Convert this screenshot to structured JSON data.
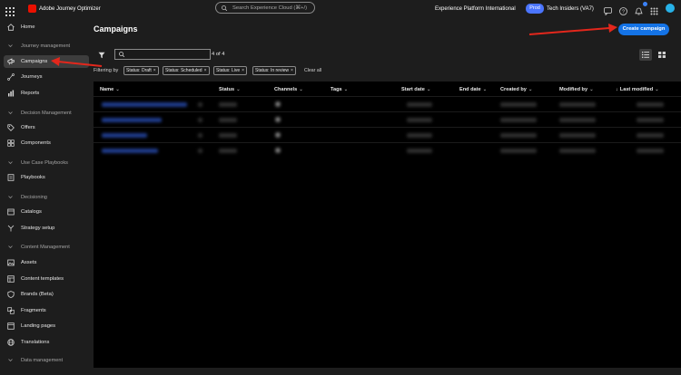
{
  "topbar": {
    "app_name": "Adobe Journey Optimizer",
    "search_placeholder": "Search Experience Cloud (⌘+/)",
    "org": "Experience Platform International",
    "env_badge": "Prod",
    "sandbox": "Tech Insiders (VA7)"
  },
  "sidebar": {
    "home": "Home",
    "journey_management": "Journey management",
    "campaigns": "Campaigns",
    "journeys": "Journeys",
    "reports": "Reports",
    "decision_management": "Decision Management",
    "offers": "Offers",
    "components": "Components",
    "use_case_playbooks": "Use Case Playbooks",
    "playbooks": "Playbooks",
    "decisioning": "Decisioning",
    "catalogs": "Catalogs",
    "strategy_setup": "Strategy setup",
    "content_management": "Content Management",
    "assets": "Assets",
    "content_templates": "Content templates",
    "brands": "Brands (Beta)",
    "fragments": "Fragments",
    "landing_pages": "Landing pages",
    "translations": "Translations",
    "data_management": "Data management"
  },
  "main": {
    "title": "Campaigns",
    "create_button": "Create campaign",
    "result_count": "4 of 4",
    "filtering_label": "Filtering by",
    "chips": [
      "Status: Draft",
      "Status: Scheduled",
      "Status: Live",
      "Status: In review"
    ],
    "clear_all": "Clear all",
    "columns": [
      "Name",
      "Status",
      "Channels",
      "Tags",
      "Start date",
      "End date",
      "Created by",
      "Modified by",
      "Last modified"
    ],
    "row_count": 4
  },
  "icons": [
    "app-grid-icon",
    "adobe-logo-icon",
    "search-icon",
    "chat-icon",
    "help-icon",
    "bell-icon",
    "apps-icon",
    "avatar",
    "filter-icon",
    "list-view-icon",
    "grid-view-icon"
  ],
  "colors": {
    "accent": "#1473e6",
    "prod_badge": "#4b75ff",
    "annotation_arrow": "#e3271c",
    "logo": "#eb1000"
  }
}
